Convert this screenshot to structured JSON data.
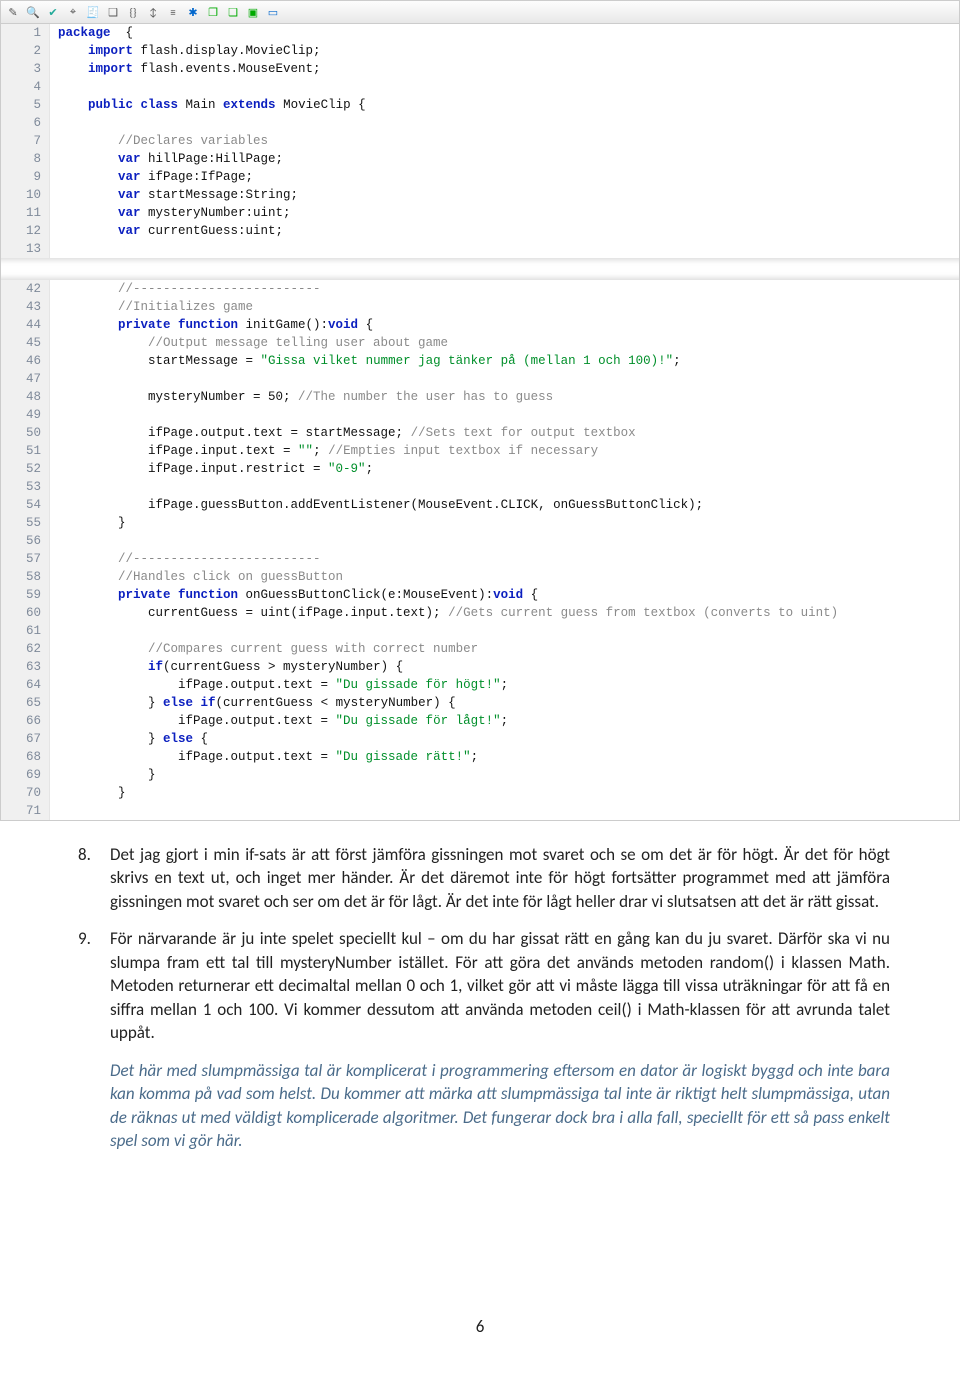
{
  "toolbar_icons": [
    "wand",
    "magnify",
    "check",
    "target",
    "tree",
    "cube",
    "braces",
    "expand",
    "collapse",
    "asterisk",
    "comment",
    "comment2",
    "box",
    "rect"
  ],
  "code1": {
    "lines": [
      1,
      2,
      3,
      4,
      5,
      6,
      7,
      8,
      9,
      10,
      11,
      12,
      13
    ],
    "rows": [
      [
        {
          "t": "package",
          "c": "kw"
        },
        {
          "t": "  {"
        }
      ],
      [
        {
          "t": "    import",
          "c": "kw"
        },
        {
          "t": " flash.display.MovieClip;"
        }
      ],
      [
        {
          "t": "    import",
          "c": "kw"
        },
        {
          "t": " flash.events.MouseEvent;"
        }
      ],
      [
        {
          "t": ""
        }
      ],
      [
        {
          "t": "    public class",
          "c": "kw"
        },
        {
          "t": " Main "
        },
        {
          "t": "extends",
          "c": "kw"
        },
        {
          "t": " MovieClip {"
        }
      ],
      [
        {
          "t": ""
        }
      ],
      [
        {
          "t": "        //Declares variables",
          "c": "cm"
        }
      ],
      [
        {
          "t": "        var",
          "c": "kw"
        },
        {
          "t": " hillPage:HillPage;"
        }
      ],
      [
        {
          "t": "        var",
          "c": "kw"
        },
        {
          "t": " ifPage:IfPage;"
        }
      ],
      [
        {
          "t": "        var",
          "c": "kw"
        },
        {
          "t": " startMessage:String;"
        }
      ],
      [
        {
          "t": "        var",
          "c": "kw"
        },
        {
          "t": " mysteryNumber:uint;"
        }
      ],
      [
        {
          "t": "        var",
          "c": "kw"
        },
        {
          "t": " currentGuess:uint;"
        }
      ],
      [
        {
          "t": ""
        }
      ]
    ]
  },
  "code2": {
    "lines": [
      42,
      43,
      44,
      45,
      46,
      47,
      48,
      49,
      50,
      51,
      52,
      53,
      54,
      55,
      56,
      57,
      58,
      59,
      60,
      61,
      62,
      63,
      64,
      65,
      66,
      67,
      68,
      69,
      70,
      71
    ],
    "rows": [
      [
        {
          "t": "        //-------------------------",
          "c": "cm"
        }
      ],
      [
        {
          "t": "        //Initializes game",
          "c": "cm"
        }
      ],
      [
        {
          "t": "        private function",
          "c": "kw"
        },
        {
          "t": " initGame():"
        },
        {
          "t": "void",
          "c": "kw"
        },
        {
          "t": " {"
        }
      ],
      [
        {
          "t": "            //Output message telling user about game",
          "c": "cm"
        }
      ],
      [
        {
          "t": "            startMessage = "
        },
        {
          "t": "\"Gissa vilket nummer jag tänker på (mellan 1 och 100)!\"",
          "c": "str"
        },
        {
          "t": ";"
        }
      ],
      [
        {
          "t": ""
        }
      ],
      [
        {
          "t": "            mysteryNumber = 50; "
        },
        {
          "t": "//The number the user has to guess",
          "c": "cm"
        }
      ],
      [
        {
          "t": ""
        }
      ],
      [
        {
          "t": "            ifPage.output.text = startMessage; "
        },
        {
          "t": "//Sets text for output textbox",
          "c": "cm"
        }
      ],
      [
        {
          "t": "            ifPage.input.text = "
        },
        {
          "t": "\"\"",
          "c": "str"
        },
        {
          "t": "; "
        },
        {
          "t": "//Empties input textbox if necessary",
          "c": "cm"
        }
      ],
      [
        {
          "t": "            ifPage.input.restrict = "
        },
        {
          "t": "\"0-9\"",
          "c": "str"
        },
        {
          "t": ";"
        }
      ],
      [
        {
          "t": ""
        }
      ],
      [
        {
          "t": "            ifPage.guessButton.addEventListener(MouseEvent.CLICK, onGuessButtonClick);"
        }
      ],
      [
        {
          "t": "        }"
        }
      ],
      [
        {
          "t": ""
        }
      ],
      [
        {
          "t": "        //-------------------------",
          "c": "cm"
        }
      ],
      [
        {
          "t": "        //Handles click on guessButton",
          "c": "cm"
        }
      ],
      [
        {
          "t": "        private function",
          "c": "kw"
        },
        {
          "t": " onGuessButtonClick(e:MouseEvent):"
        },
        {
          "t": "void",
          "c": "kw"
        },
        {
          "t": " {"
        }
      ],
      [
        {
          "t": "            currentGuess = uint(ifPage.input.text); "
        },
        {
          "t": "//Gets current guess from textbox (converts to uint)",
          "c": "cm"
        }
      ],
      [
        {
          "t": ""
        }
      ],
      [
        {
          "t": "            //Compares current guess with correct number",
          "c": "cm"
        }
      ],
      [
        {
          "t": "            if",
          "c": "kw"
        },
        {
          "t": "(currentGuess > mysteryNumber) {"
        }
      ],
      [
        {
          "t": "                ifPage.output.text = "
        },
        {
          "t": "\"Du gissade för högt!\"",
          "c": "str"
        },
        {
          "t": ";"
        }
      ],
      [
        {
          "t": "            } "
        },
        {
          "t": "else if",
          "c": "kw"
        },
        {
          "t": "(currentGuess < mysteryNumber) {"
        }
      ],
      [
        {
          "t": "                ifPage.output.text = "
        },
        {
          "t": "\"Du gissade för lågt!\"",
          "c": "str"
        },
        {
          "t": ";"
        }
      ],
      [
        {
          "t": "            } "
        },
        {
          "t": "else",
          "c": "kw"
        },
        {
          "t": " {"
        }
      ],
      [
        {
          "t": "                ifPage.output.text = "
        },
        {
          "t": "\"Du gissade rätt!\"",
          "c": "str"
        },
        {
          "t": ";"
        }
      ],
      [
        {
          "t": "            }"
        }
      ],
      [
        {
          "t": "        }"
        }
      ],
      [
        {
          "t": ""
        }
      ]
    ]
  },
  "article": {
    "item8_num": "8.",
    "item8": "Det jag gjort i min if-sats är att först jämföra gissningen mot svaret och se om det är för högt. Är det för högt skrivs en text ut, och inget mer händer. Är det däremot inte för högt fortsätter programmet med att jämföra gissningen mot svaret och ser om det är för lågt. Är det inte för lågt heller drar vi slutsatsen att det är rätt gissat.",
    "item9_num": "9.",
    "item9": "För närvarande är ju inte spelet speciellt kul – om du har gissat rätt en gång kan du ju svaret. Därför ska vi nu slumpa fram ett tal till mysteryNumber istället. För att göra det används metoden random() i klassen Math. Metoden returnerar ett decimaltal mellan 0 och 1, vilket gör att vi måste lägga till vissa uträkningar för att få en siffra mellan 1 och 100. Vi kommer dessutom att använda metoden ceil() i Math-klassen för att avrunda talet uppåt.",
    "note": "Det här med slumpmässiga tal är komplicerat i programmering eftersom en dator är logiskt byggd och inte bara kan komma på vad som helst. Du kommer att märka att slumpmässiga tal inte är riktigt helt slumpmässiga, utan de räknas ut med väldigt komplicerade algoritmer. Det fungerar dock bra i alla fall, speciellt för ett så pass enkelt spel som vi gör här."
  },
  "page_number": "6"
}
